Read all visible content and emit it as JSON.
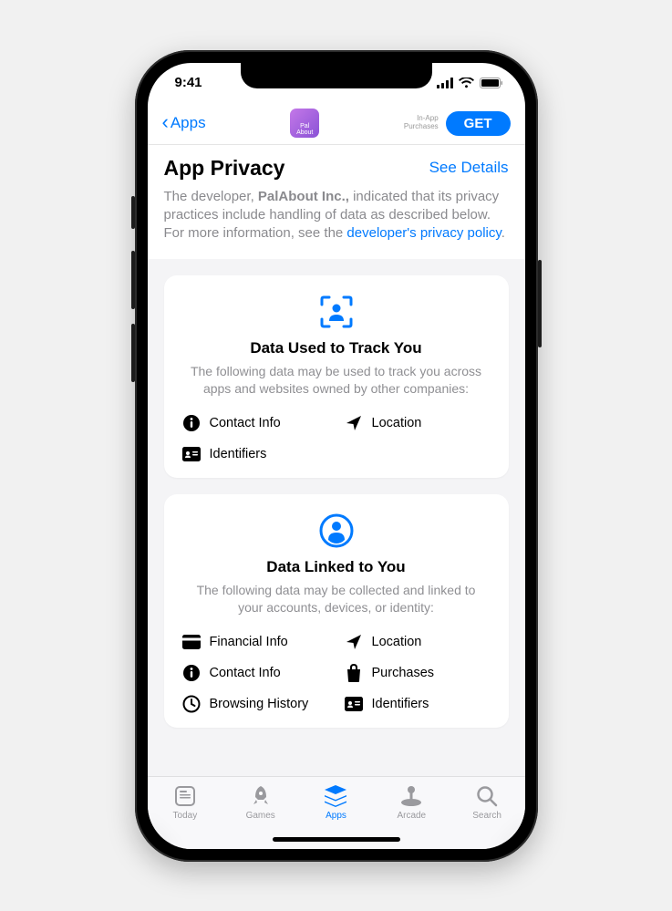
{
  "status": {
    "time": "9:41"
  },
  "nav": {
    "back_label": "Apps",
    "app_chip": "Pal\nAbout",
    "iap_line1": "In-App",
    "iap_line2": "Purchases",
    "get_label": "GET"
  },
  "header": {
    "title": "App Privacy",
    "see_details": "See Details",
    "desc_pre": "The developer, ",
    "developer": "PalAbout Inc.,",
    "desc_mid": " indicated that its privacy practices include handling of data as described below. For more information, see the ",
    "link": "developer's privacy policy",
    "desc_post": "."
  },
  "cards": [
    {
      "icon": "track-icon",
      "title": "Data Used to Track You",
      "desc": "The following data may be used to track you across apps and websites owned by other companies:",
      "items": [
        {
          "icon": "info",
          "label": "Contact Info"
        },
        {
          "icon": "location",
          "label": "Location"
        },
        {
          "icon": "id",
          "label": "Identifiers"
        }
      ]
    },
    {
      "icon": "linked-icon",
      "title": "Data Linked to You",
      "desc": "The following data may be collected and linked to your accounts, devices, or identity:",
      "items": [
        {
          "icon": "card",
          "label": "Financial Info"
        },
        {
          "icon": "location",
          "label": "Location"
        },
        {
          "icon": "info",
          "label": "Contact Info"
        },
        {
          "icon": "bag",
          "label": "Purchases"
        },
        {
          "icon": "clock",
          "label": "Browsing History"
        },
        {
          "icon": "id",
          "label": "Identifiers"
        }
      ]
    }
  ],
  "tabs": [
    {
      "icon": "today",
      "label": "Today"
    },
    {
      "icon": "rocket",
      "label": "Games"
    },
    {
      "icon": "stack",
      "label": "Apps",
      "active": true
    },
    {
      "icon": "arcade",
      "label": "Arcade"
    },
    {
      "icon": "search",
      "label": "Search"
    }
  ],
  "colors": {
    "accent": "#007aff"
  }
}
